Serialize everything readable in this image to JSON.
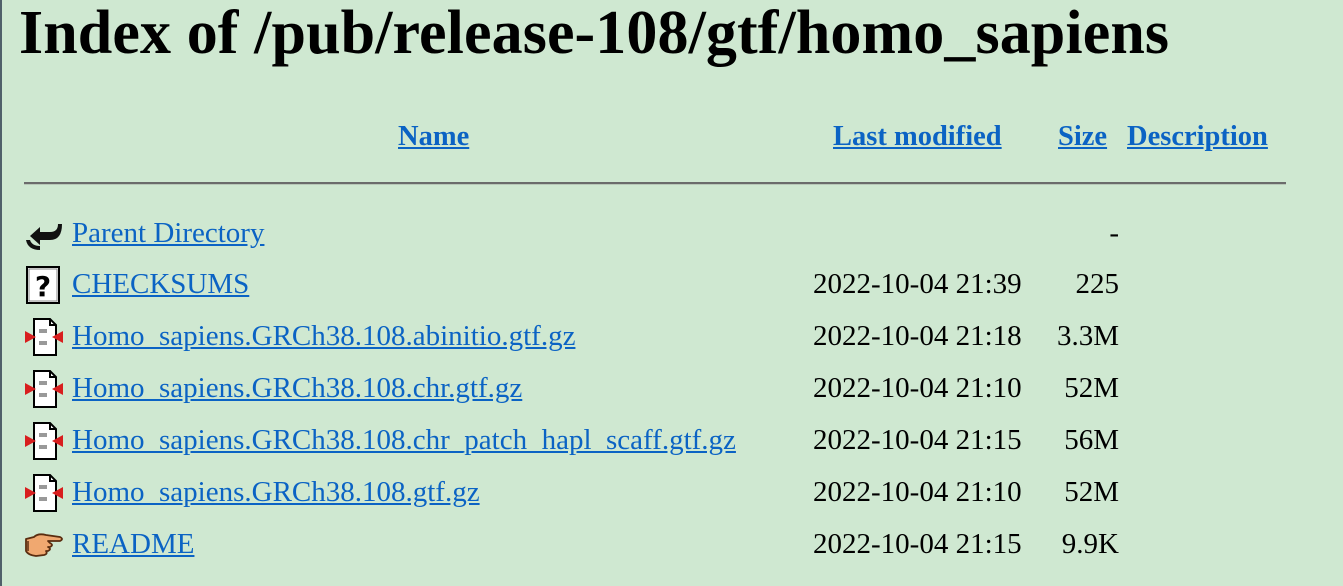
{
  "page": {
    "title": "Index of /pub/release-108/gtf/homo_sapiens"
  },
  "columns": {
    "name": "Name",
    "last_modified": "Last modified",
    "size": "Size",
    "description": "Description"
  },
  "rows": [
    {
      "icon": "back-arrow-icon",
      "name": "Parent Directory",
      "modified": "",
      "size": "-"
    },
    {
      "icon": "unknown-file-icon",
      "name": "CHECKSUMS",
      "modified": "2022-10-04 21:39",
      "size": "225"
    },
    {
      "icon": "compressed-file-icon",
      "name": "Homo_sapiens.GRCh38.108.abinitio.gtf.gz",
      "modified": "2022-10-04 21:18",
      "size": "3.3M"
    },
    {
      "icon": "compressed-file-icon",
      "name": "Homo_sapiens.GRCh38.108.chr.gtf.gz",
      "modified": "2022-10-04 21:10",
      "size": "52M"
    },
    {
      "icon": "compressed-file-icon",
      "name": "Homo_sapiens.GRCh38.108.chr_patch_hapl_scaff.gtf.gz",
      "modified": "2022-10-04 21:15",
      "size": "56M"
    },
    {
      "icon": "compressed-file-icon",
      "name": "Homo_sapiens.GRCh38.108.gtf.gz",
      "modified": "2022-10-04 21:10",
      "size": "52M"
    },
    {
      "icon": "pointing-hand-icon",
      "name": "README",
      "modified": "2022-10-04 21:15",
      "size": "9.9K"
    }
  ]
}
